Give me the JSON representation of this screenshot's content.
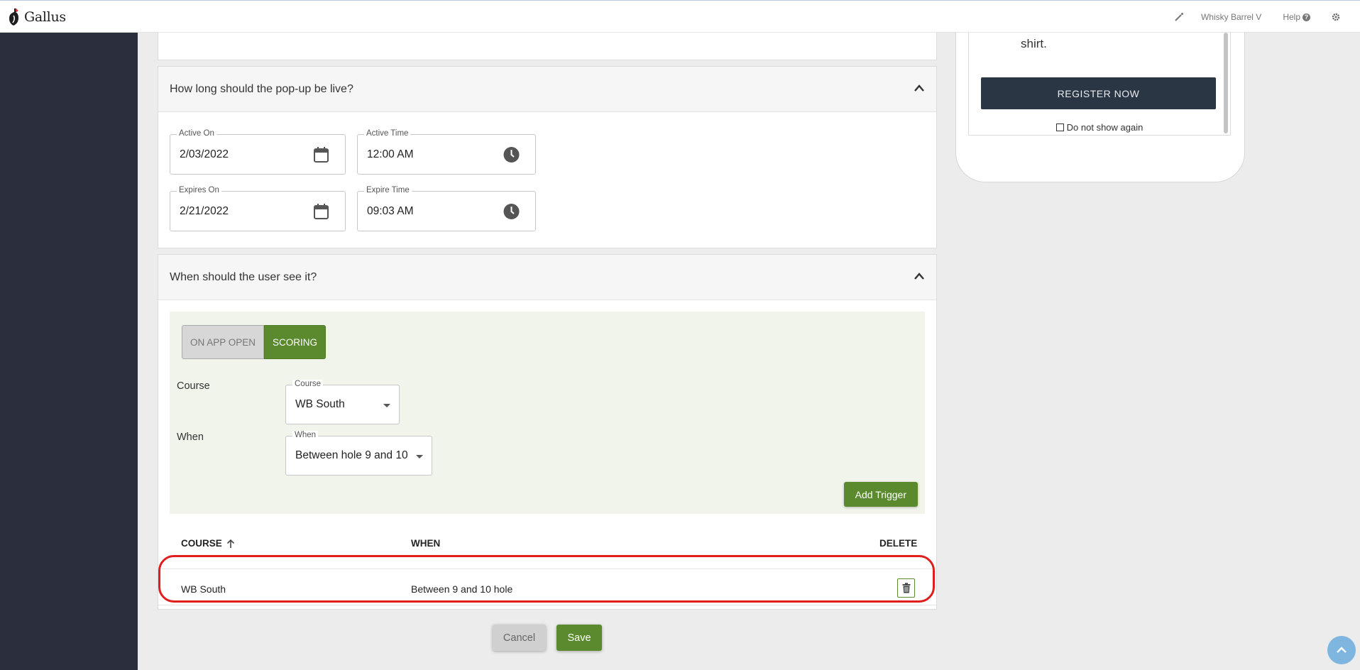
{
  "app": {
    "name": "Gallus"
  },
  "topbar": {
    "org_name": "Whisky Barrel V",
    "help_label": "Help",
    "help_icon_text": "?"
  },
  "preview": {
    "text": "shirt.",
    "register_label": "REGISTER NOW",
    "do_not_show_label": "Do not show again"
  },
  "live_section": {
    "title": "How long should the pop-up be live?",
    "active_on": {
      "label": "Active On",
      "value": "2/03/2022"
    },
    "active_time": {
      "label": "Active Time",
      "value": "12:00 AM"
    },
    "expires_on": {
      "label": "Expires On",
      "value": "2/21/2022"
    },
    "expire_time": {
      "label": "Expire Time",
      "value": "09:03 AM"
    }
  },
  "trigger_section": {
    "title": "When should the user see it?",
    "mode_options": [
      "ON APP OPEN",
      "SCORING"
    ],
    "selected_mode": "SCORING",
    "course_row_label": "Course",
    "course_select": {
      "label": "Course",
      "value": "WB South"
    },
    "when_row_label": "When",
    "when_select": {
      "label": "When",
      "value": "Between hole 9 and 10"
    },
    "add_trigger_label": "Add Trigger"
  },
  "table": {
    "headers": {
      "course": "COURSE",
      "when": "WHEN",
      "delete": "DELETE"
    },
    "rows": [
      {
        "course": "WB South",
        "when": "Between 9 and 10 hole"
      }
    ]
  },
  "actions": {
    "cancel_label": "Cancel",
    "save_label": "Save"
  },
  "colors": {
    "accent_green": "#5b8a2e",
    "sidebar": "#2b2f3d",
    "highlight": "#e01e1e"
  }
}
